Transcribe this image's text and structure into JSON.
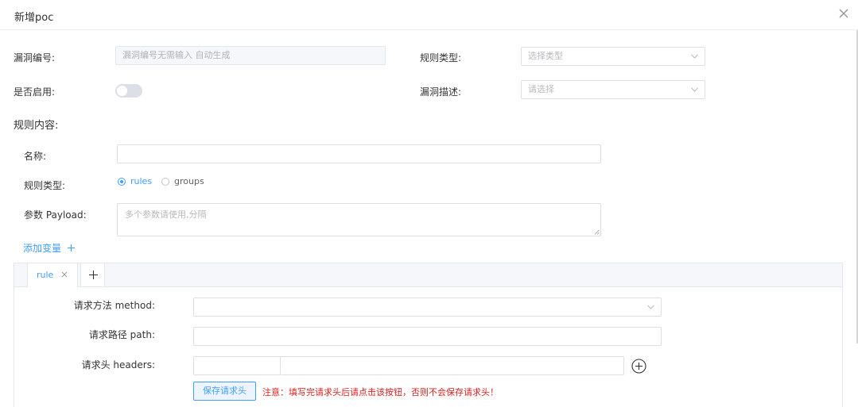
{
  "dialog": {
    "title": "新增poc"
  },
  "form": {
    "vuln_id": {
      "label": "漏洞编号:",
      "placeholder": "漏洞编号无需输入 自动生成"
    },
    "rule_type": {
      "label": "规则类型:",
      "placeholder": "选择类型"
    },
    "enabled": {
      "label": "是否启用:",
      "value": false
    },
    "vuln_desc": {
      "label": "漏洞描述:",
      "placeholder": "请选择"
    }
  },
  "rule_content": {
    "section_title": "规则内容:",
    "name": {
      "label": "名称:",
      "value": ""
    },
    "type": {
      "label": "规则类型:",
      "options": [
        "rules",
        "groups"
      ],
      "selected": "rules"
    },
    "payload": {
      "label": "参数 Payload:",
      "placeholder": "多个参数请使用,分隔"
    },
    "add_variable": "添加变量"
  },
  "tabs": [
    {
      "label": "rule",
      "active": true
    }
  ],
  "rule_form": {
    "method": {
      "label": "请求方法 method:",
      "value": ""
    },
    "path": {
      "label": "请求路径 path:",
      "value": ""
    },
    "headers": {
      "label": "请求头 headers:",
      "key": "",
      "value": ""
    },
    "save_headers_button": "保存请求头",
    "warning": "注意：填写完请求头后请点击该按钮，否则不会保存请求头！"
  },
  "icons": {
    "close": "close-icon",
    "chevron": "chevron-down-icon",
    "plus": "plus-icon",
    "plus_circle": "plus-circle-icon"
  },
  "colors": {
    "accent": "#409eff",
    "warning": "#e02020",
    "border": "#dcdfe6"
  }
}
